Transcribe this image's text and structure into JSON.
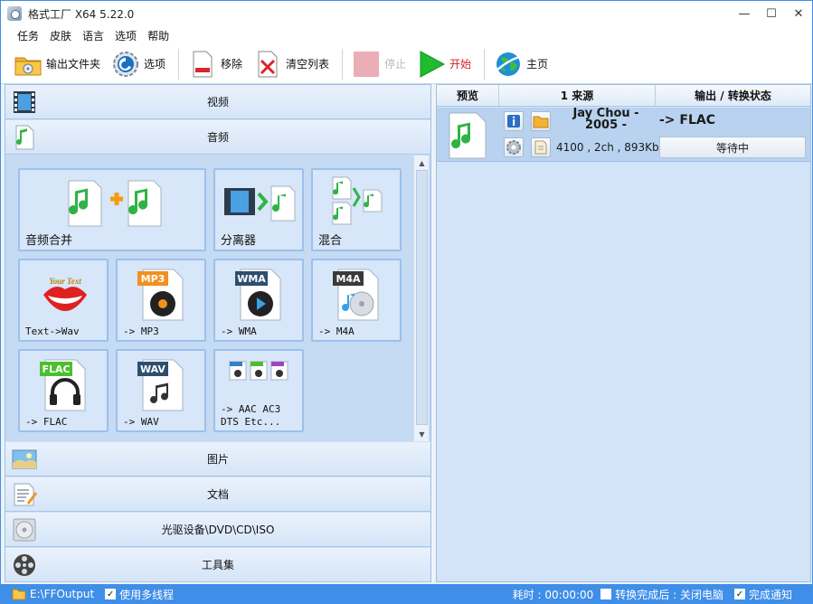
{
  "window": {
    "title": "格式工厂 X64 5.22.0",
    "controls": {
      "minimize": "—",
      "maximize": "☐",
      "close": "✕"
    }
  },
  "menu": [
    "任务",
    "皮肤",
    "语言",
    "选项",
    "帮助"
  ],
  "toolbar": {
    "output_folder": "输出文件夹",
    "options": "选项",
    "remove": "移除",
    "clear_list": "清空列表",
    "stop": "停止",
    "start": "开始",
    "home": "主页"
  },
  "categories": {
    "video": "视频",
    "audio": "音频",
    "picture": "图片",
    "document": "文档",
    "optical": "光驱设备\\DVD\\CD\\ISO",
    "tools": "工具集"
  },
  "audio_tiles": {
    "merge": "音频合并",
    "splitter": "分离器",
    "mix": "混合",
    "text_wav": "Text->Wav",
    "mp3": "-> MP3",
    "wma": "-> WMA",
    "m4a": "-> M4A",
    "flac": "-> FLAC",
    "wav": "-> WAV",
    "aac": "-> AAC AC3\nDTS Etc...",
    "badges": {
      "mp3": "MP3",
      "wma": "WMA",
      "m4a": "M4A",
      "flac": "FLAC",
      "wav": "WAV",
      "your_text": "Your Text"
    }
  },
  "task_list": {
    "headers": {
      "preview": "预览",
      "source": "1 来源",
      "output": "输出 / 转换状态"
    },
    "rows": [
      {
        "source_title_line1": "Jay Chou -",
        "source_title_line2": "2005 -",
        "source_info": "4100 , 2ch , 893Kb",
        "output_format": "-> FLAC",
        "status": "等待中"
      }
    ]
  },
  "statusbar": {
    "output_path": "E:\\FFOutput",
    "multithread_label": "使用多线程",
    "elapsed": "耗时 : 00:00:00",
    "after_done_label": "转换完成后 : 关闭电脑",
    "notify_label": "完成通知",
    "check_mark": "✓"
  }
}
